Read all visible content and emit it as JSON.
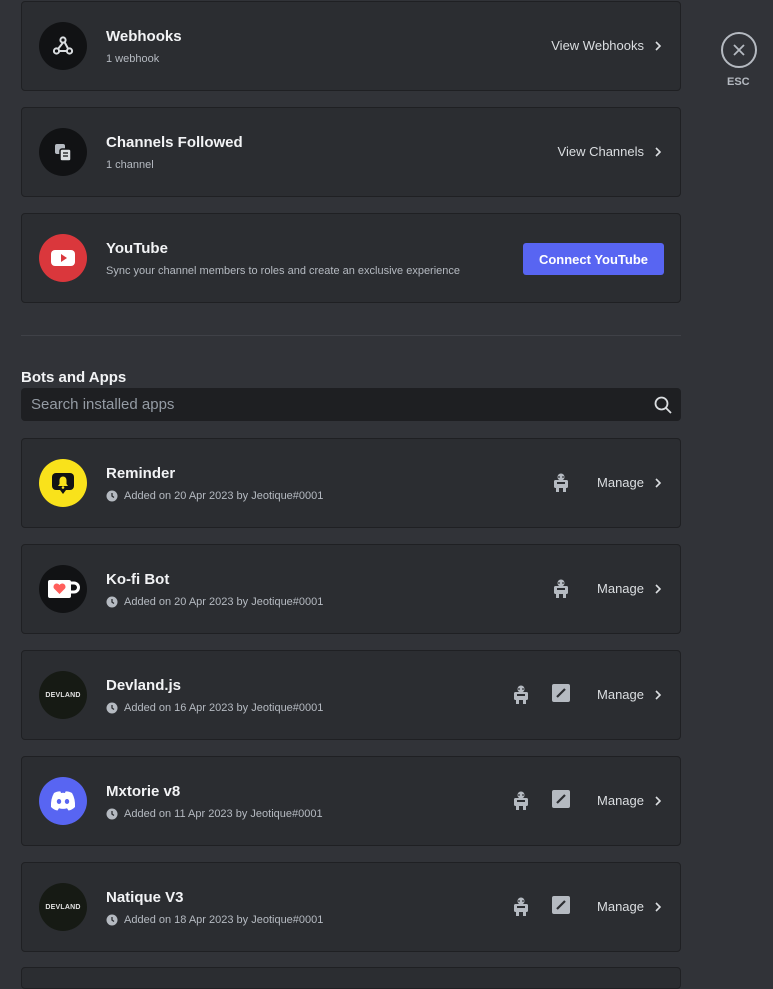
{
  "integrations": [
    {
      "title": "Webhooks",
      "subtitle": "1 webhook",
      "action": "View Webhooks",
      "icon": "webhook-icon"
    },
    {
      "title": "Channels Followed",
      "subtitle": "1 channel",
      "action": "View Channels",
      "icon": "channels-followed-icon"
    },
    {
      "title": "YouTube",
      "subtitle": "Sync your channel members to roles and create an exclusive experience",
      "action": "Connect YouTube",
      "icon": "youtube-icon"
    }
  ],
  "bots_section": {
    "title": "Bots and Apps",
    "search_placeholder": "Search installed apps"
  },
  "apps": [
    {
      "name": "Reminder",
      "added": "Added on 20 Apr 2023 by Jeotique#0001",
      "manage": "Manage",
      "avatar": "bell-icon"
    },
    {
      "name": "Ko-fi Bot",
      "added": "Added on 20 Apr 2023 by Jeotique#0001",
      "manage": "Manage",
      "avatar": "kofi-cup-icon"
    },
    {
      "name": "Devland.js",
      "added": "Added on 16 Apr 2023 by Jeotique#0001",
      "manage": "Manage",
      "avatar_text": "DEVLAND"
    },
    {
      "name": "Mxtorie v8",
      "added": "Added on 11 Apr 2023 by Jeotique#0001",
      "manage": "Manage",
      "avatar": "discord-icon"
    },
    {
      "name": "Natique V3",
      "added": "Added on 18 Apr 2023 by Jeotique#0001",
      "manage": "Manage",
      "avatar_text": "DEVLAND"
    }
  ],
  "esc_label": "ESC",
  "colors": {
    "accent": "#5865f2",
    "youtube": "#da373c",
    "reminder": "#f9e21b",
    "discord": "#5865f2"
  }
}
